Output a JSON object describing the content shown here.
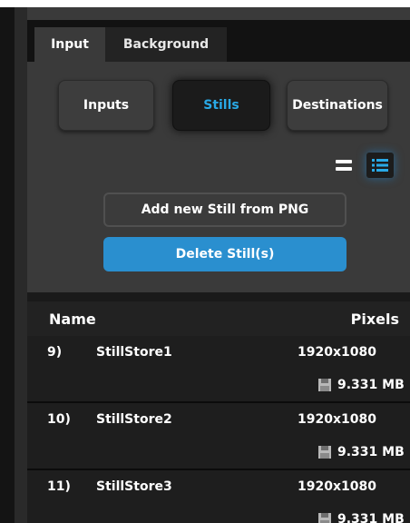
{
  "tabs": [
    {
      "label": "Input",
      "active": true
    },
    {
      "label": "Background",
      "active": false
    }
  ],
  "mode_buttons": {
    "inputs": "Inputs",
    "stills": "Stills",
    "destinations": "Destinations",
    "selected": "Stills"
  },
  "view_toggles": [
    "list-compact-icon",
    "list-detail-icon"
  ],
  "actions": {
    "add_label": "Add new Still from PNG",
    "delete_label": "Delete Still(s)"
  },
  "list": {
    "columns": [
      "Name",
      "Pixels"
    ],
    "rows": [
      {
        "index": "9)",
        "name": "StillStore1",
        "resolution": "1920x1080",
        "size": "9.331 MB"
      },
      {
        "index": "10)",
        "name": "StillStore2",
        "resolution": "1920x1080",
        "size": "9.331 MB"
      },
      {
        "index": "11)",
        "name": "StillStore3",
        "resolution": "1920x1080",
        "size": "9.331 MB"
      }
    ]
  },
  "colors": {
    "accent": "#29a9e6",
    "delete_button": "#2a8fcf",
    "panel": "#3a3a3a"
  }
}
